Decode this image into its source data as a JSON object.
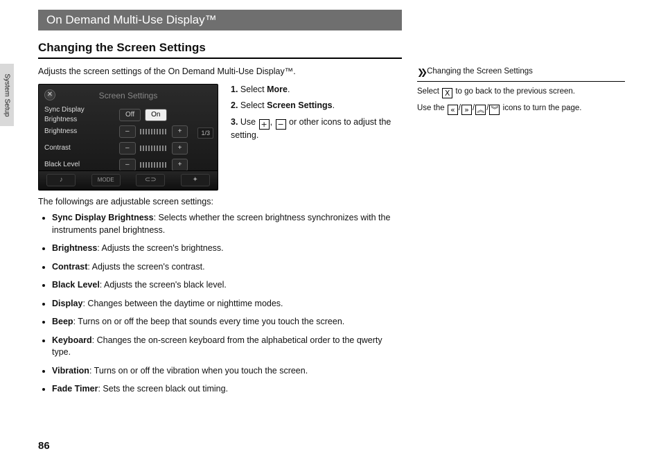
{
  "page_number": "86",
  "side_tab": "System Setup",
  "header": "On Demand Multi-Use Display™",
  "section_title": "Changing the Screen Settings",
  "intro": "Adjusts the screen settings of the On Demand Multi-Use Display™.",
  "figure": {
    "title": "Screen Settings",
    "close": "✕",
    "rows": {
      "sync": {
        "label": "Sync Display Brightness",
        "off": "Off",
        "on": "On"
      },
      "bright": {
        "label": "Brightness",
        "minus": "–",
        "plus": "+"
      },
      "contr": {
        "label": "Contrast",
        "minus": "–",
        "plus": "+"
      },
      "black": {
        "label": "Black Level",
        "minus": "–",
        "plus": "+"
      }
    },
    "pager": "1/3",
    "bottom_mode": "MODE"
  },
  "steps": [
    {
      "lead": "1. ",
      "pre": "Select ",
      "kw": "More",
      "post": "."
    },
    {
      "lead": "2. ",
      "pre": "Select ",
      "kw": "Screen Settings",
      "post": "."
    }
  ],
  "step3": {
    "lead": "3. ",
    "pre": "Use ",
    "mid": ", ",
    "post": " or other icons to adjust the setting."
  },
  "followings": "The followings are adjustable screen settings:",
  "settings": [
    {
      "name": "Sync Display Brightness",
      "desc": ": Selects whether the screen brightness synchronizes with the instruments panel brightness."
    },
    {
      "name": "Brightness",
      "desc": ": Adjusts the screen's brightness."
    },
    {
      "name": "Contrast",
      "desc": ": Adjusts the screen's contrast."
    },
    {
      "name": "Black Level",
      "desc": ": Adjusts the screen's black level."
    },
    {
      "name": "Display",
      "desc": ": Changes between the daytime or nighttime modes."
    },
    {
      "name": "Beep",
      "desc": ": Turns on or off the beep that sounds every time you touch the screen."
    },
    {
      "name": "Keyboard",
      "desc": ": Changes the on-screen keyboard from the alphabetical order to the qwerty type."
    },
    {
      "name": "Vibration",
      "desc": ": Turns on or off the vibration when you touch the screen."
    },
    {
      "name": "Fade Timer",
      "desc": ": Sets the screen black out timing."
    }
  ],
  "right": {
    "head": "Changing the Screen Settings",
    "line1a": "Select ",
    "line1b": " to go back to the previous screen.",
    "line2a": "Use the ",
    "line2b": " icons to turn the page."
  },
  "glyphs": {
    "plus": "+",
    "minus": "−",
    "x": "X",
    "sep": "/",
    "dl": "«",
    "dr": "»",
    "du": "︽",
    "dd": "︾",
    "skip": "❯❯"
  }
}
